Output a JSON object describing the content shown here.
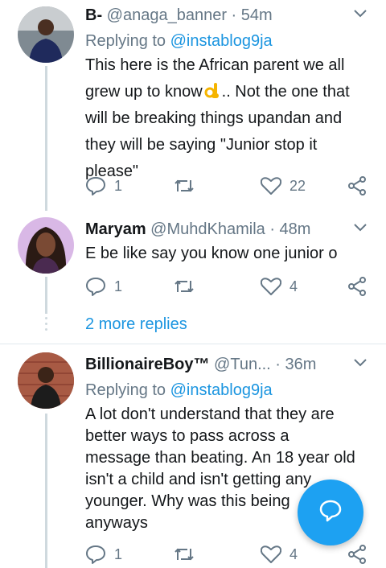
{
  "tweets": [
    {
      "name": "B-",
      "handle": "@anaga_banner",
      "time": "54m",
      "replying_prefix": "Replying to ",
      "replying_to": "@instablog9ja",
      "text_lines": [
        "This here is the African parent we all",
        "grew up to know",
        ".. Not the one that",
        "will be breaking things upandan and",
        "they will be saying \"Junior stop it",
        "please\""
      ],
      "reply_count": "1",
      "like_count": "22"
    },
    {
      "name": "Maryam",
      "handle": "@MuhdKhamila",
      "time": "48m",
      "text": "E be like say you know one junior o",
      "reply_count": "1",
      "like_count": "4"
    },
    {
      "name": "BillionaireBoy™",
      "handle": "@Tun...",
      "time": "36m",
      "replying_prefix": "Replying to ",
      "replying_to": "@instablog9ja",
      "text_lines": [
        "A lot don't understand that they are",
        "better ways to pass across a",
        "message than beating. An 18 year old",
        "isn't a child and isn't getting any",
        "younger. Why was this being",
        "anyways"
      ],
      "reply_count": "1",
      "like_count": "4"
    }
  ],
  "more_replies_label": "2 more replies",
  "separator": " · ",
  "colors": {
    "accent": "#1b95e0",
    "fab": "#1da1f2",
    "secondary_text": "#657786"
  },
  "icons": [
    "reply-icon",
    "retweet-icon",
    "like-icon",
    "share-icon",
    "caret-down-icon",
    "compose-reply-icon",
    "ok-hand-emoji"
  ]
}
